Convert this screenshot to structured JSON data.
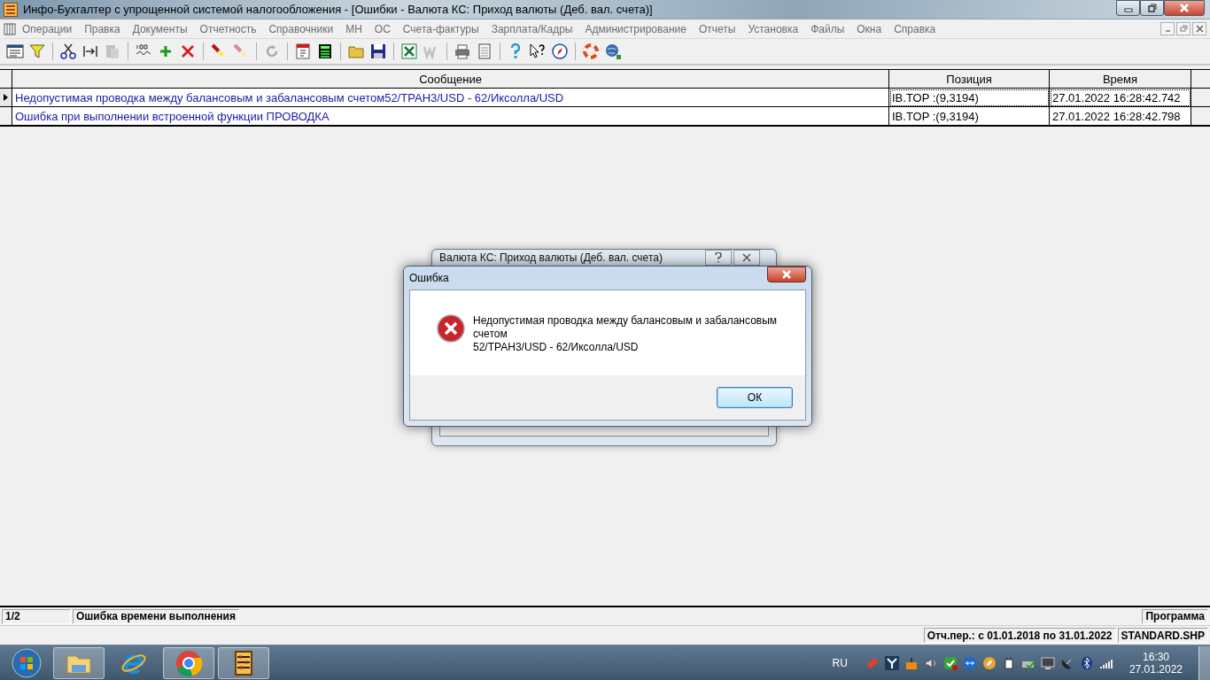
{
  "window": {
    "title": "Инфо-Бухгалтер с упрощенной системой налогообложения - [Ошибки - Валюта КС: Приход валюты (Деб. вал. счета)]"
  },
  "menu": [
    "Операции",
    "Правка",
    "Документы",
    "Отчетность",
    "Справочники",
    "МН",
    "ОС",
    "Счета-фактуры",
    "Зарплата/Кадры",
    "Администрирование",
    "Отчеты",
    "Установка",
    "Файлы",
    "Окна",
    "Справка"
  ],
  "toolbar": [
    {
      "kind": "grid",
      "disabled": false
    },
    {
      "kind": "filter",
      "disabled": false
    },
    {
      "kind": "sep"
    },
    {
      "kind": "cut",
      "disabled": false
    },
    {
      "kind": "arrows",
      "disabled": false
    },
    {
      "kind": "paste",
      "disabled": true
    },
    {
      "kind": "sep"
    },
    {
      "kind": "number",
      "disabled": false
    },
    {
      "kind": "plus",
      "disabled": false
    },
    {
      "kind": "cross",
      "disabled": false
    },
    {
      "kind": "sep"
    },
    {
      "kind": "torch",
      "disabled": false
    },
    {
      "kind": "torch",
      "disabled": true
    },
    {
      "kind": "sep"
    },
    {
      "kind": "refresh",
      "disabled": true
    },
    {
      "kind": "sep"
    },
    {
      "kind": "calendar",
      "disabled": false
    },
    {
      "kind": "calculator",
      "disabled": false
    },
    {
      "kind": "sep"
    },
    {
      "kind": "folder",
      "disabled": false
    },
    {
      "kind": "disk",
      "disabled": false
    },
    {
      "kind": "sep"
    },
    {
      "kind": "excel",
      "disabled": false
    },
    {
      "kind": "word",
      "disabled": true
    },
    {
      "kind": "sep"
    },
    {
      "kind": "printer",
      "disabled": false
    },
    {
      "kind": "page",
      "disabled": false
    },
    {
      "kind": "sep"
    },
    {
      "kind": "help",
      "disabled": false
    },
    {
      "kind": "pointer-help",
      "disabled": false
    },
    {
      "kind": "compass",
      "disabled": false
    },
    {
      "kind": "sep"
    },
    {
      "kind": "lifebuoy",
      "disabled": false
    },
    {
      "kind": "globe",
      "disabled": false
    }
  ],
  "table": {
    "columns": [
      "Сообщение",
      "Позиция",
      "Время"
    ],
    "rows": [
      {
        "cells": [
          "Недопустимая проводка между балансовым и забалансовым счетом52/ТРАН3/USD - 62/Иксолла/USD",
          "IB.TOP :(9,3194)",
          "27.01.2022 16:28:42.742"
        ],
        "selected": true
      },
      {
        "cells": [
          "Ошибка при выполнении встроенной функции ПРОВОДКА",
          "IB.TOP :(9,3194)",
          "27.01.2022 16:28:42.798"
        ],
        "selected": false
      }
    ]
  },
  "status_bar": {
    "counter": "1/2",
    "message": "Ошибка времени выполнения",
    "mode": "Программа"
  },
  "period_bar": {
    "period": "Отч.пер.: с 01.01.2018 по 31.01.2022",
    "file": "STANDARD.SHP"
  },
  "back_dialog": {
    "title": "Валюта КС: Приход валюты (Деб. вал. счета)"
  },
  "error_dialog": {
    "title": "Ошибка",
    "message": [
      "Недопустимая проводка между балансовым и забалансовым счетом",
      "52/ТРАН3/USD - 62/Иксолла/USD"
    ],
    "button": "ОК"
  },
  "taskbar": {
    "apps": [
      {
        "kind": "explorer"
      },
      {
        "kind": "ie"
      },
      {
        "kind": "chrome"
      },
      {
        "kind": "abacus"
      }
    ],
    "language": "RU",
    "time": "16:30",
    "date": "27.01.2022"
  }
}
